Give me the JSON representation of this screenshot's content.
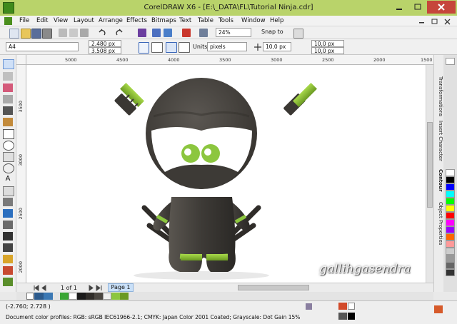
{
  "window": {
    "title": "CorelDRAW X6 - [E:\\_DATA\\FL\\Tutorial Ninja.cdr]"
  },
  "menu": [
    "File",
    "Edit",
    "View",
    "Layout",
    "Arrange",
    "Effects",
    "Bitmaps",
    "Text",
    "Table",
    "Tools",
    "Window",
    "Help"
  ],
  "toolbar": {
    "zoom": "24%",
    "snap": "Snap to"
  },
  "property_bar": {
    "page_size": "A4",
    "width": "2.480 px",
    "height": "3.508 px",
    "units_label": "Units:",
    "units": "pixels",
    "nudge": "10,0 px",
    "dup_x": "10,0 px",
    "dup_y": "10,0 px"
  },
  "ruler": {
    "horizontal": [
      "5000",
      "4500",
      "4000",
      "3500",
      "3000",
      "2500",
      "2000",
      "1500"
    ],
    "vertical": [
      "3500",
      "3000",
      "2500",
      "2000"
    ]
  },
  "dockers": [
    "Transformations",
    "Insert Character",
    "Contour",
    "Object Properties"
  ],
  "page_nav": {
    "counter": "1 of 1",
    "page_tab": "Page 1"
  },
  "watermark": "gallihgasendra",
  "status": {
    "coords": "(-2.760; 2.728 )",
    "profiles": "Document color profiles: RGB: sRGB IEC61966-2.1; CMYK: Japan Color 2001 Coated; Grayscale: Dot Gain 15%"
  },
  "colors": {
    "titlebar": "#b9d36a",
    "ninja_body": "#3d3a36",
    "ninja_accent": "#8cc63f",
    "eye_white": "#ffffff",
    "palette": [
      "#ffffff",
      "#000000",
      "#0000ff",
      "#00ffff",
      "#00ff00",
      "#ffff00",
      "#ff0000",
      "#ff00ff",
      "#9900ff",
      "#ff6600",
      "#ff9999",
      "#cccccc",
      "#999999",
      "#666666",
      "#333333"
    ]
  }
}
